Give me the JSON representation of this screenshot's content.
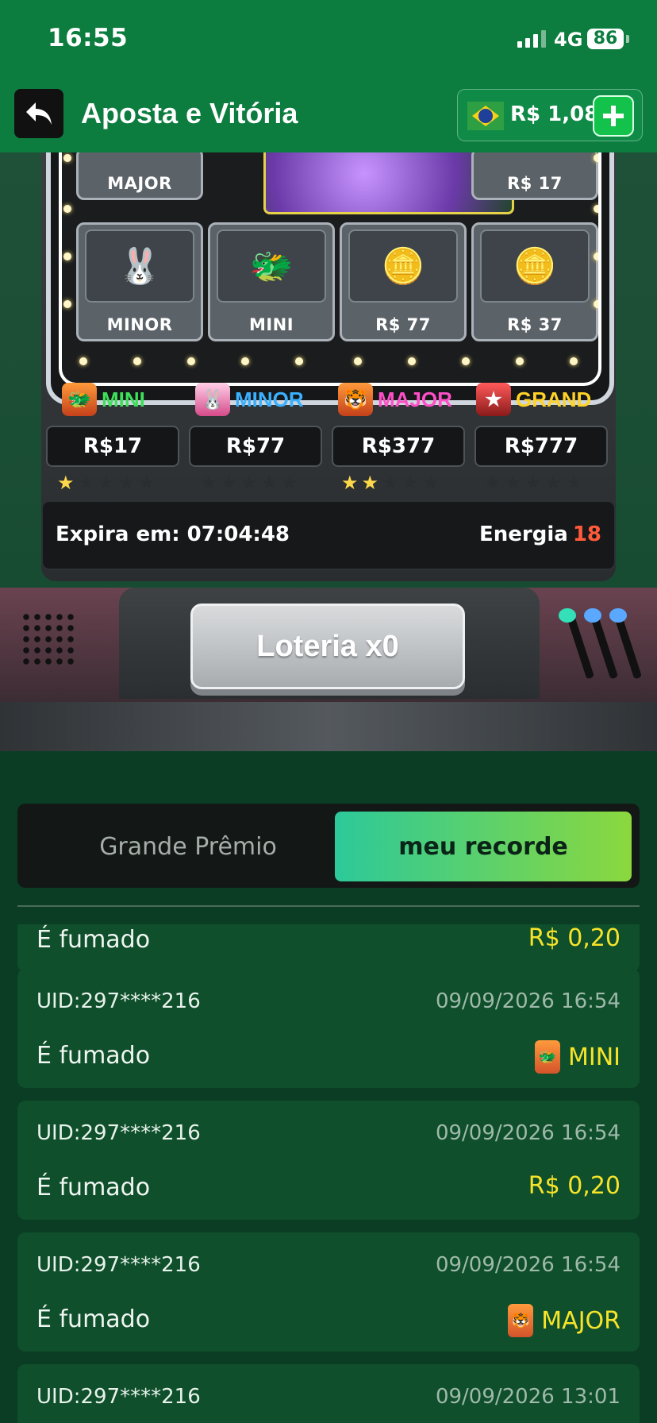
{
  "status_bar": {
    "time": "16:55",
    "network": "4G",
    "battery": "86"
  },
  "header": {
    "title": "Aposta e Vitória",
    "balance": "R$ 1,08"
  },
  "reels": {
    "top_row": [
      "MAJOR",
      "R$ 17"
    ],
    "bottom_row": [
      "MINOR",
      "MINI",
      "R$ 77",
      "R$ 37"
    ]
  },
  "jackpots": [
    {
      "name": "MINI",
      "value": "R$17",
      "stars_lit": 1,
      "color": "#3ee05a"
    },
    {
      "name": "MINOR",
      "value": "R$77",
      "stars_lit": 0,
      "color": "#3ab0ff"
    },
    {
      "name": "MAJOR",
      "value": "R$377",
      "stars_lit": 2,
      "color": "#ff4fc8"
    },
    {
      "name": "GRAND",
      "value": "R$777",
      "stars_lit": 0,
      "color": "#ffd326"
    }
  ],
  "info": {
    "expira_label": "Expira em:",
    "expira_time": "07:04:48",
    "energia_label": "Energia",
    "energia_value": "18"
  },
  "lottery_button": "Loteria x0",
  "tabs": {
    "grande": "Grande Prêmio",
    "recorde": "meu recorde"
  },
  "records": [
    {
      "uid": "",
      "date": "",
      "kind": "É fumado",
      "prize": "R$ 0,20",
      "icon": ""
    },
    {
      "uid": "UID:297****216",
      "date": "09/09/2026 16:54",
      "kind": "É fumado",
      "prize": "MINI",
      "icon": "wild-dragon-icon"
    },
    {
      "uid": "UID:297****216",
      "date": "09/09/2026 16:54",
      "kind": "É fumado",
      "prize": "R$ 0,20",
      "icon": ""
    },
    {
      "uid": "UID:297****216",
      "date": "09/09/2026 16:54",
      "kind": "É fumado",
      "prize": "MAJOR",
      "icon": "wild-tiger-icon"
    },
    {
      "uid": "UID:297****216",
      "date": "09/09/2026 13:01",
      "kind": "",
      "prize": "",
      "icon": ""
    }
  ],
  "colors": {
    "header_green": "#0d7d3f",
    "accent_yellow": "#f6e42a",
    "energy_red": "#ff5a3a"
  }
}
